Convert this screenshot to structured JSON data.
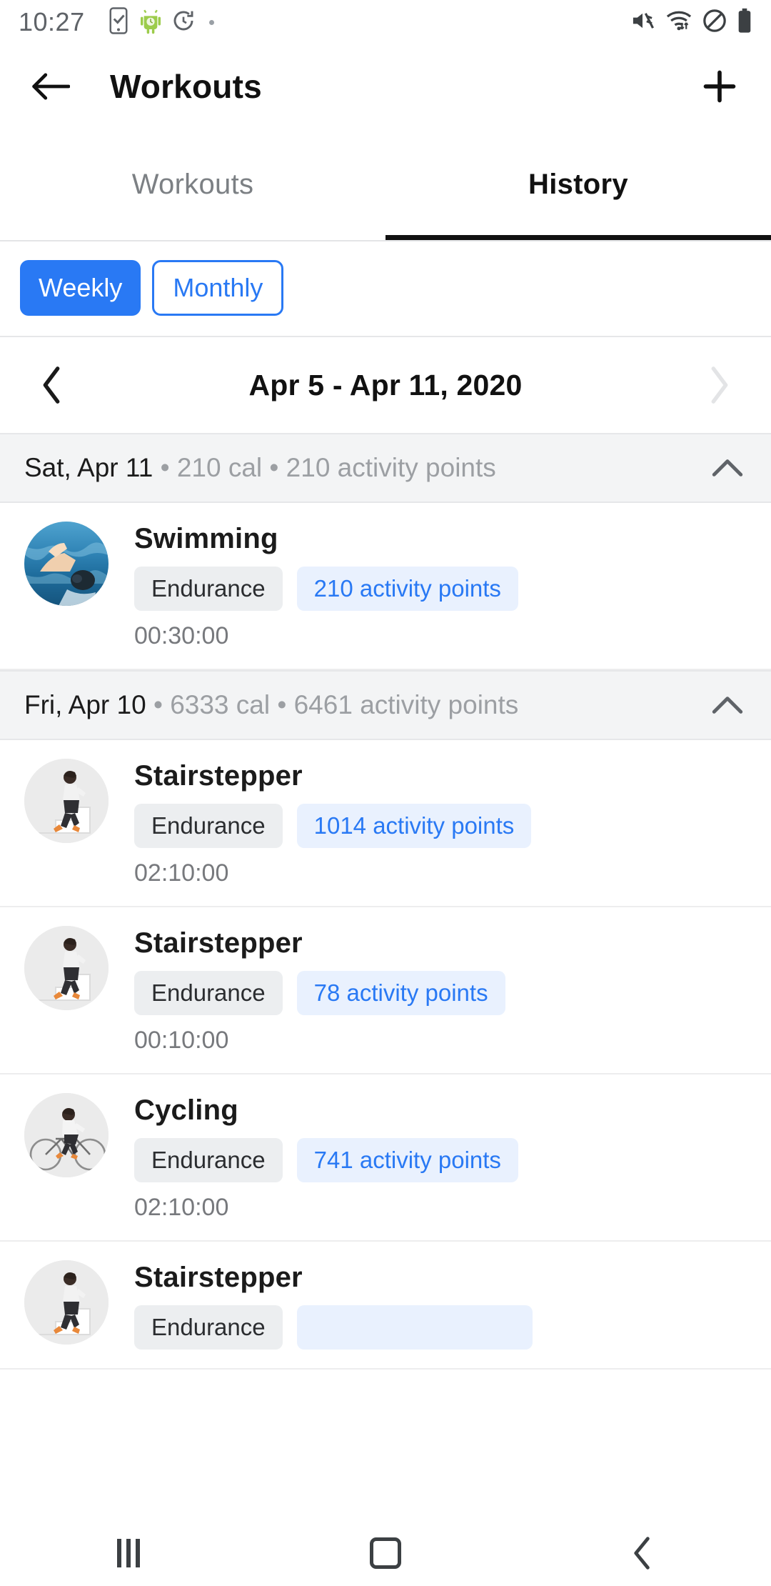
{
  "status_bar": {
    "time": "10:27",
    "left_icons": [
      "phone-check-icon",
      "android-robot-icon",
      "history-timer-icon",
      "dot-icon"
    ],
    "right_icons": [
      "volume-mute-icon",
      "wifi-icon",
      "do-not-disturb-icon",
      "battery-full-icon"
    ]
  },
  "app_bar": {
    "back_icon": "arrow-left-icon",
    "title": "Workouts",
    "add_icon": "plus-icon"
  },
  "tabs": [
    {
      "label": "Workouts",
      "active": false
    },
    {
      "label": "History",
      "active": true
    }
  ],
  "filter": {
    "weekly_label": "Weekly",
    "monthly_label": "Monthly",
    "selected": "Weekly",
    "accent_color": "#2979F4"
  },
  "date_nav": {
    "prev_icon": "chevron-left-icon",
    "next_icon": "chevron-right-icon",
    "range_label": "Apr 5 - Apr 11, 2020",
    "prev_enabled": true,
    "next_enabled": false
  },
  "groups": [
    {
      "date_label": "Sat, Apr 11",
      "meta": " • 210 cal • 210 activity points",
      "collapse_icon": "chevron-up-icon",
      "workouts": [
        {
          "name": "Swimming",
          "thumb": "swimming-photo",
          "type_chip": "Endurance",
          "points_chip": "210 activity points",
          "duration": "00:30:00"
        }
      ]
    },
    {
      "date_label": "Fri, Apr 10",
      "meta": " • 6333 cal • 6461 activity points",
      "collapse_icon": "chevron-up-icon",
      "workouts": [
        {
          "name": "Stairstepper",
          "thumb": "stairstepper-photo",
          "type_chip": "Endurance",
          "points_chip": "1014 activity points",
          "duration": "02:10:00"
        },
        {
          "name": "Stairstepper",
          "thumb": "stairstepper-photo",
          "type_chip": "Endurance",
          "points_chip": "78 activity points",
          "duration": "00:10:00"
        },
        {
          "name": "Cycling",
          "thumb": "cycling-photo",
          "type_chip": "Endurance",
          "points_chip": "741 activity points",
          "duration": "02:10:00"
        },
        {
          "name": "Stairstepper",
          "thumb": "stairstepper-photo",
          "type_chip": "Endurance",
          "points_chip": "",
          "duration": ""
        }
      ]
    }
  ],
  "nav_bar": {
    "recents_icon": "recents-icon",
    "home_icon": "home-icon",
    "back_icon": "back-chevron-icon"
  }
}
